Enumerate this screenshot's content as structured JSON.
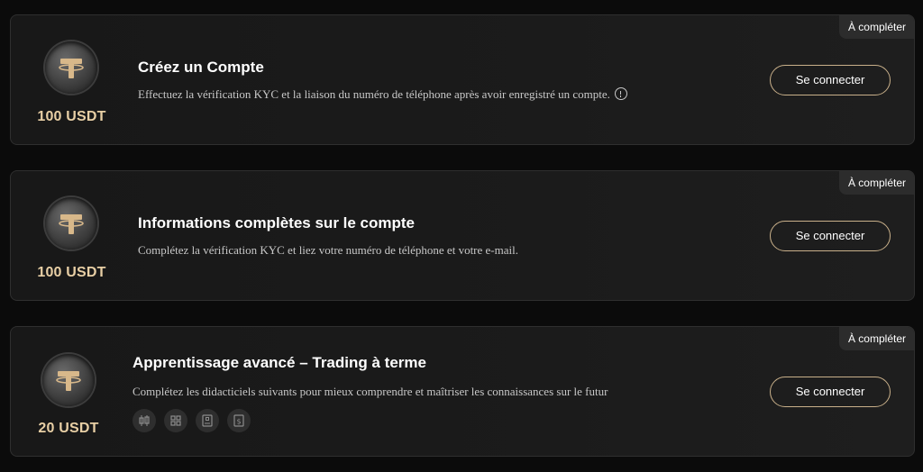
{
  "colors": {
    "background": "#0b0b0b",
    "card": "#1b1b1b",
    "accent_gold": "#c9b08a",
    "reward_text": "#e8cfa5"
  },
  "tasks": [
    {
      "status": "À compléter",
      "reward": "100 USDT",
      "title": "Créez un Compte",
      "description": "Effectuez la vérification KYC et la liaison du numéro de téléphone après avoir enregistré un compte.",
      "has_info_icon": true,
      "button_label": "Se connecter",
      "icon": "tether-coin-icon"
    },
    {
      "status": "À compléter",
      "reward": "100 USDT",
      "title": "Informations complètes sur le compte",
      "description": "Complétez la vérification KYC et liez votre numéro de téléphone et votre e-mail.",
      "has_info_icon": false,
      "button_label": "Se connecter",
      "icon": "tether-coin-icon"
    },
    {
      "status": "À compléter",
      "reward": "20 USDT",
      "title": "Apprentissage avancé – Trading à terme",
      "description": "Complétez les didacticiels suivants pour mieux comprendre et maîtriser les connaissances sur le futur",
      "has_info_icon": false,
      "button_label": "Se connecter",
      "icon": "tether-coin-icon",
      "tutorial_icons": [
        "candlestick-chart-icon",
        "grid-layout-icon",
        "book-icon",
        "dollar-document-icon"
      ]
    }
  ]
}
